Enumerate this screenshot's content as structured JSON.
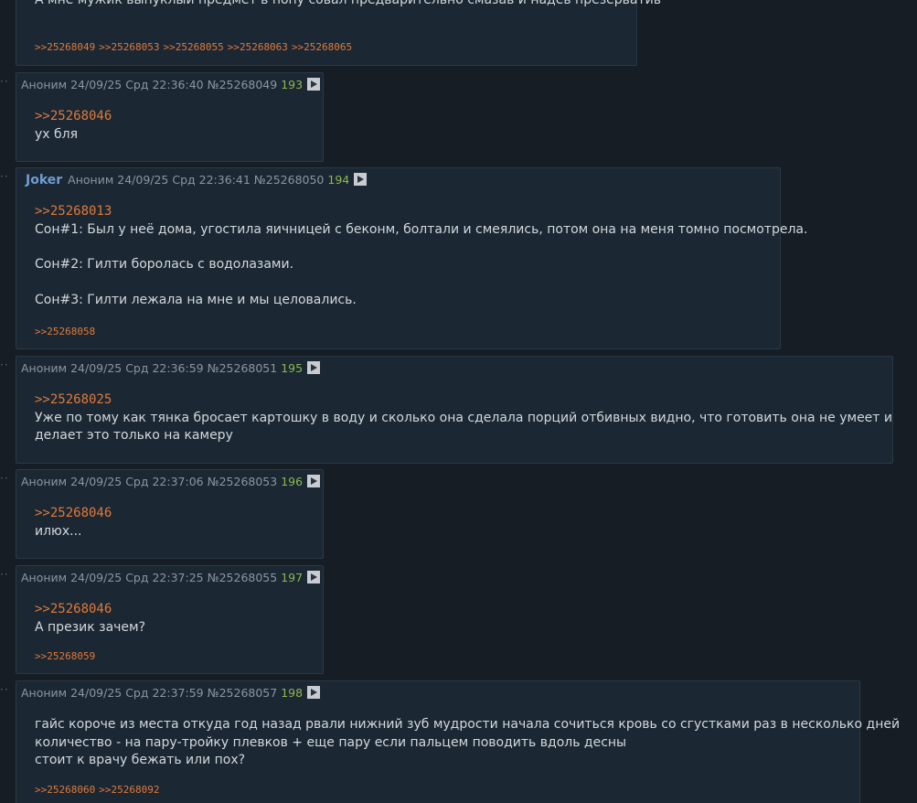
{
  "posts": [
    {
      "show_header": false,
      "lines": [
        {
          "type": "text",
          "text": "А мне мужик выпуклый предмет в попу совал предварительно смазав и надев презерватив"
        }
      ],
      "replies": [
        ">>25268049",
        ">>25268053",
        ">>25268055",
        ">>25268063",
        ">>25268065"
      ]
    },
    {
      "show_header": true,
      "author": "Аноним",
      "date": "24/09/25 Срд 22:36:40",
      "post_no": "№25268049",
      "counter": "193",
      "lines": [
        {
          "type": "ref",
          "text": ">>25268046"
        },
        {
          "type": "text",
          "text": "ух бля"
        }
      ],
      "replies": []
    },
    {
      "show_header": true,
      "trip": "Joker",
      "author": "Аноним",
      "date": "24/09/25 Срд 22:36:41",
      "post_no": "№25268050",
      "counter": "194",
      "lines": [
        {
          "type": "ref",
          "text": ">>25268013"
        },
        {
          "type": "text",
          "text": "Сон#1: Был у неё дома, угостила яичницей с беконм, болтали и смеялись, потом она на меня томно посмотрела."
        },
        {
          "type": "gap"
        },
        {
          "type": "text",
          "text": "Сон#2: Гилти боролась с водолазами."
        },
        {
          "type": "gap"
        },
        {
          "type": "text",
          "text": "Сон#3: Гилти лежала на мне и мы целовались."
        }
      ],
      "replies": [
        ">>25268058"
      ]
    },
    {
      "show_header": true,
      "author": "Аноним",
      "date": "24/09/25 Срд 22:36:59",
      "post_no": "№25268051",
      "counter": "195",
      "lines": [
        {
          "type": "ref",
          "text": ">>25268025"
        },
        {
          "type": "text",
          "text": "Уже по тому как тянка бросает картошку в воду и сколько она сделала порций отбивных видно, что готовить она не умеет и"
        },
        {
          "type": "text",
          "text": "делает это только на камеру"
        }
      ],
      "replies": []
    },
    {
      "show_header": true,
      "author": "Аноним",
      "date": "24/09/25 Срд 22:37:06",
      "post_no": "№25268053",
      "counter": "196",
      "lines": [
        {
          "type": "ref",
          "text": ">>25268046"
        },
        {
          "type": "text",
          "text": "илюх..."
        }
      ],
      "replies": []
    },
    {
      "show_header": true,
      "author": "Аноним",
      "date": "24/09/25 Срд 22:37:25",
      "post_no": "№25268055",
      "counter": "197",
      "lines": [
        {
          "type": "ref",
          "text": ">>25268046"
        },
        {
          "type": "text",
          "text": "А презик зачем?"
        }
      ],
      "replies": [
        ">>25268059"
      ]
    },
    {
      "show_header": true,
      "author": "Аноним",
      "date": "24/09/25 Срд 22:37:59",
      "post_no": "№25268057",
      "counter": "198",
      "lines": [
        {
          "type": "text",
          "text": "гайс короче из места откуда год назад рвали нижний зуб мудрости начала сочиться кровь со сгустками раз в несколько дней"
        },
        {
          "type": "text",
          "text": "количество - на пару-тройку плевков + еще пару если пальцем поводить вдоль десны"
        },
        {
          "type": "text",
          "text": "стоит к врачу бежать или пох?"
        }
      ],
      "replies": [
        ">>25268060",
        ">>25268092"
      ]
    }
  ]
}
